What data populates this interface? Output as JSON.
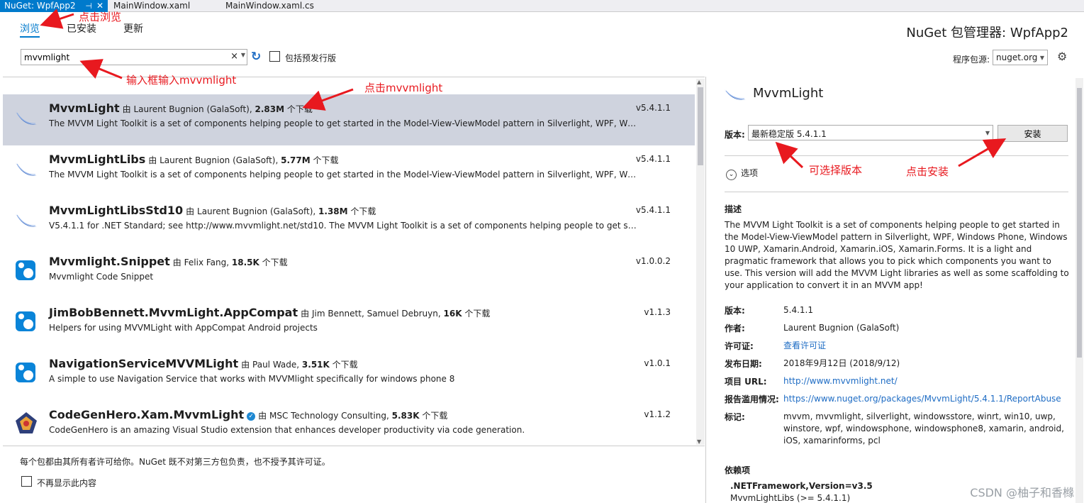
{
  "tabs": [
    {
      "label": "NuGet: WpfApp2"
    },
    {
      "label": "MainWindow.xaml"
    },
    {
      "label": "MainWindow.xaml.cs"
    }
  ],
  "nav": {
    "browse": "浏览",
    "installed": "已安装",
    "updates": "更新"
  },
  "page_title": "NuGet 包管理器: WpfApp2",
  "search": {
    "value": "mvvmlight",
    "clear": "×"
  },
  "prerelease_label": "包括预发行版",
  "source": {
    "label": "程序包源:",
    "value": "nuget.org"
  },
  "by_label": "由",
  "download_suffix": "个下载",
  "packages": [
    {
      "name": "MvvmLight",
      "author": "Laurent Bugnion (GalaSoft),",
      "downloads": "2.83M",
      "version": "v5.4.1.1",
      "desc": "The MVVM Light Toolkit is a set of components helping people to get started in the Model-View-ViewModel pattern in Silverlight, WPF, Wi..."
    },
    {
      "name": "MvvmLightLibs",
      "author": "Laurent Bugnion (GalaSoft),",
      "downloads": "5.77M",
      "version": "v5.4.1.1",
      "desc": "The MVVM Light Toolkit is a set of components helping people to get started in the Model-View-ViewModel pattern in Silverlight, WPF, Wi..."
    },
    {
      "name": "MvvmLightLibsStd10",
      "author": "Laurent Bugnion (GalaSoft),",
      "downloads": "1.38M",
      "version": "v5.4.1.1",
      "desc": "V5.4.1.1 for .NET Standard; see http://www.mvvmlight.net/std10. The MVVM Light Toolkit is a set of components helping people to get star..."
    },
    {
      "name": "Mvvmlight.Snippet",
      "author": "Felix Fang,",
      "downloads": "18.5K",
      "version": "v1.0.0.2",
      "desc": "Mvvmlight Code Snippet"
    },
    {
      "name": "JimBobBennett.MvvmLight.AppCompat",
      "author": "Jim Bennett, Samuel Debruyn,",
      "downloads": "16K",
      "version": "v1.1.3",
      "desc": "Helpers for using MVVMLight with AppCompat Android projects"
    },
    {
      "name": "NavigationServiceMVVMLight",
      "author": "Paul Wade,",
      "downloads": "3.51K",
      "version": "v1.0.1",
      "desc": "A simple to use Navigation Service that works with MVVMlight specifically for windows phone 8"
    },
    {
      "name": "CodeGenHero.Xam.MvvmLight",
      "author": "MSC Technology Consulting,",
      "downloads": "5.83K",
      "version": "v1.1.2",
      "desc": "CodeGenHero is an amazing Visual Studio extension that enhances developer productivity via code generation."
    }
  ],
  "footer": {
    "note": "每个包都由其所有者许可给你。NuGet 既不对第三方包负责，也不授予其许可证。",
    "dont_show": "不再显示此内容"
  },
  "detail": {
    "title": "MvvmLight",
    "version_label": "版本:",
    "version_value": "最新稳定版 5.4.1.1",
    "install": "安装",
    "options": "选项",
    "desc_heading": "描述",
    "description": "The MVVM Light Toolkit is a set of components helping people to get started in the Model-View-ViewModel pattern in Silverlight, WPF, Windows Phone, Windows 10 UWP, Xamarin.Android, Xamarin.iOS, Xamarin.Forms. It is a light and pragmatic framework that allows you to pick which components you want to use. This version will add the MVVM Light libraries as well as some scaffolding to your application to convert it in an MVVM app!",
    "meta": {
      "version_k": "版本:",
      "version_v": "5.4.1.1",
      "author_k": "作者:",
      "author_v": "Laurent Bugnion (GalaSoft)",
      "license_k": "许可证:",
      "license_v": "查看许可证",
      "date_k": "发布日期:",
      "date_v": "2018年9月12日 (2018/9/12)",
      "url_k": "项目 URL:",
      "url_v": "http://www.mvvmlight.net/",
      "abuse_k": "报告滥用情况:",
      "abuse_v": "https://www.nuget.org/packages/MvvmLight/5.4.1.1/ReportAbuse",
      "tags_k": "标记:",
      "tags_v": "mvvm, mvvmlight, silverlight, windowsstore, winrt, win10, uwp, winstore, wpf, windowsphone, windowsphone8, xamarin, android, iOS, xamarinforms, pcl"
    },
    "deps_heading": "依赖项",
    "dep_group": ".NETFramework,Version=v3.5",
    "dep_item": "MvvmLightLibs (>= 5.4.1.1)"
  },
  "annotations": {
    "click_browse": "点击浏览",
    "input_search": "输入框输入mvvmlight",
    "click_pkg": "点击mvvmlight",
    "choose_version": "可选择版本",
    "click_install": "点击安装"
  },
  "watermark": "CSDN @柚子和香橼",
  "colors": {
    "accent": "#007acc",
    "selected_row": "#cfd3de",
    "annotation": "#e8191f"
  }
}
